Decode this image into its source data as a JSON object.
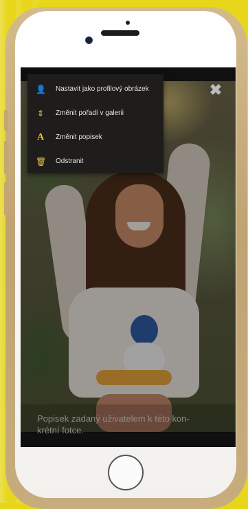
{
  "menu": {
    "items": [
      {
        "icon": "user-icon",
        "glyph": "👤",
        "label": "Nastavit jako profilový obrázek"
      },
      {
        "icon": "reorder-icon",
        "glyph": "⇕",
        "label": "Změnit pořadí v galerii"
      },
      {
        "icon": "text-icon",
        "glyph": "A",
        "label": "Změnit popisek"
      },
      {
        "icon": "trash-icon",
        "glyph": "🗑",
        "label": "Odstranit"
      }
    ]
  },
  "close": {
    "glyph": "✖"
  },
  "caption": {
    "line1": "Popisek zadaný uživatelem k této kon-",
    "line2": "krétní fotce."
  },
  "colors": {
    "background": "#e8d61a",
    "menu_bg": "#1e1d1b",
    "menu_icon": "#e7c64a",
    "phone_frame": "#c6a66d"
  }
}
